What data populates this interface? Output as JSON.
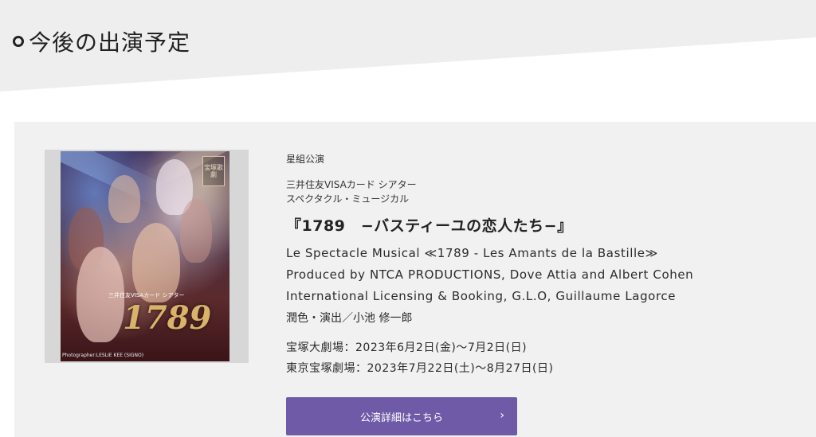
{
  "section": {
    "title": "今後の出演予定",
    "ring_icon": "circle-bullet-icon",
    "band_color": "#eeeeee"
  },
  "performance": {
    "troupe": "星組公演",
    "sponsor": "三井住友VISAカード シアター",
    "genre": "スペクタクル・ミュージカル",
    "title": "『1789　−バスティーユの恋人たち−』",
    "credits_en": [
      "Le Spectacle Musical ≪1789 - Les Amants de la Bastille≫",
      "Produced by NTCA PRODUCTIONS, Dove Attia and Albert Cohen",
      "International Licensing & Booking, G.L.O, Guillaume Lagorce"
    ],
    "staff": "潤色・演出／小池 修一郎",
    "schedule": [
      "宝塚大劇場：2023年6月2日(金)〜7月2日(日)",
      "東京宝塚劇場：2023年7月22日(土)〜8月27日(日)"
    ],
    "poster": {
      "title_text": "1789",
      "sponsor_text": "三井住友VISAカード シアター",
      "crest_text": "宝塚歌劇",
      "photo_credit": "Photographer:LESLIE KEE (SIGNO)"
    }
  },
  "button": {
    "label": "公演詳細はこちら",
    "icon": "chevron-right-icon",
    "color": "#6f5aa8"
  }
}
